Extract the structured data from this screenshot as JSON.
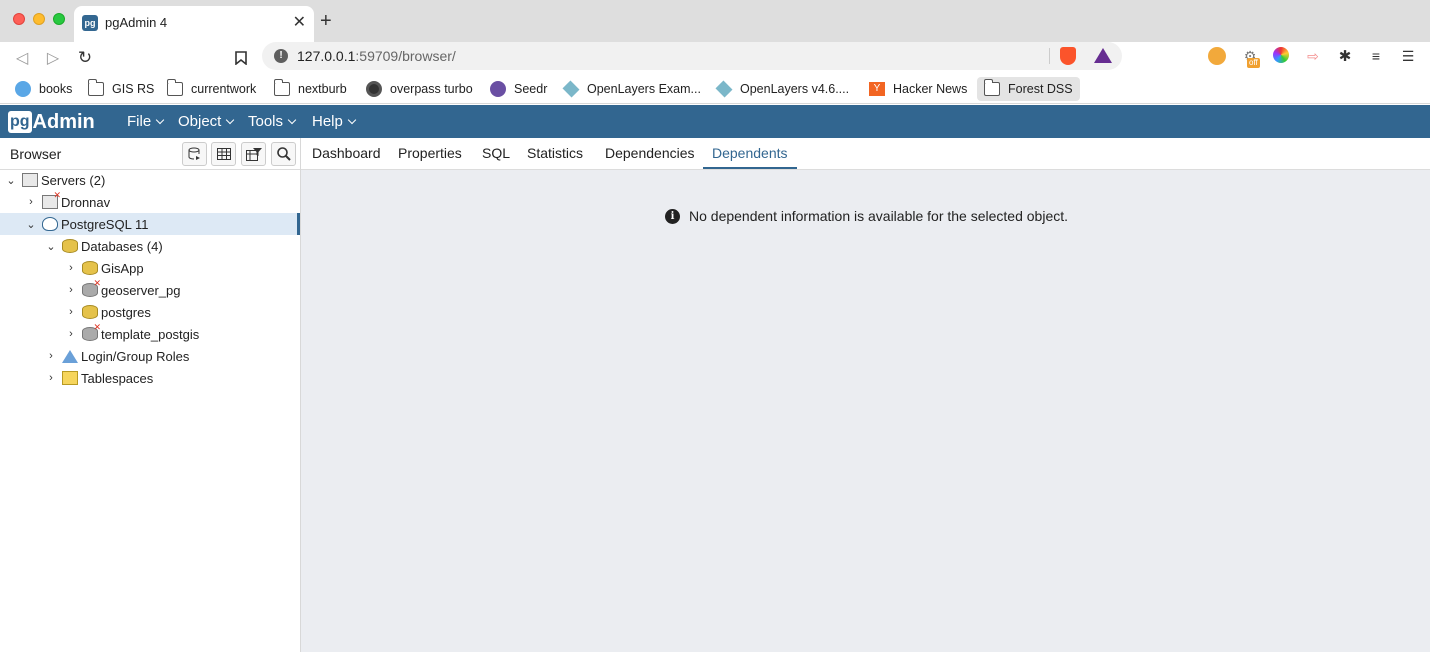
{
  "browser": {
    "tab_title": "pgAdmin 4",
    "tab_favicon": "pg",
    "url_host": "127.0.0.1",
    "url_rest": ":59709/browser/",
    "bookmarks": [
      {
        "label": "books",
        "icon": "globe-icon"
      },
      {
        "label": "GIS RS",
        "icon": "folder-icon"
      },
      {
        "label": "currentwork",
        "icon": "folder-icon"
      },
      {
        "label": "nextburb",
        "icon": "folder-icon"
      },
      {
        "label": "overpass turbo",
        "icon": "overpass-icon"
      },
      {
        "label": "Seedr",
        "icon": "seedr-icon"
      },
      {
        "label": "OpenLayers Exam...",
        "icon": "openlayers-icon"
      },
      {
        "label": "OpenLayers v4.6....",
        "icon": "openlayers-icon"
      },
      {
        "label": "Hacker News",
        "icon": "hackernews-icon"
      },
      {
        "label": "Forest DSS",
        "icon": "folder-icon"
      }
    ],
    "ext_badge": "off"
  },
  "pgadmin": {
    "logo_pg": "pg",
    "logo_text": "Admin",
    "menus": [
      "File",
      "Object",
      "Tools",
      "Help"
    ],
    "sidebar_title": "Browser",
    "tree": [
      {
        "label": "Servers (2)"
      },
      {
        "label": "Dronnav"
      },
      {
        "label": "PostgreSQL 11"
      },
      {
        "label": "Databases (4)"
      },
      {
        "label": "GisApp"
      },
      {
        "label": "geoserver_pg"
      },
      {
        "label": "postgres"
      },
      {
        "label": "template_postgis"
      },
      {
        "label": "Login/Group Roles"
      },
      {
        "label": "Tablespaces"
      }
    ],
    "tabs": [
      "Dashboard",
      "Properties",
      "SQL",
      "Statistics",
      "Dependencies",
      "Dependents"
    ],
    "active_tab": "Dependents",
    "message": "No dependent information is available for the selected object.",
    "colors": {
      "header": "#326690",
      "selected_row": "#dde9f5",
      "content_bg": "#ebedf1"
    }
  }
}
